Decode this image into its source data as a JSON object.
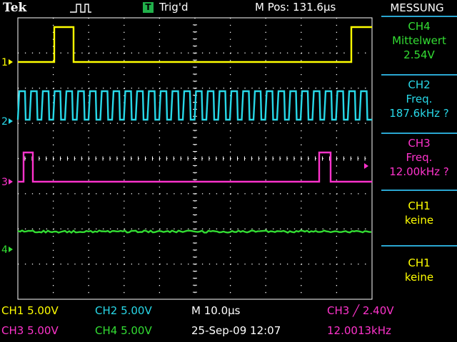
{
  "header": {
    "brand": "Tek",
    "trigger_icon": "T",
    "trigger_state": "Trig'd",
    "m_pos": "M Pos: 131.6µs"
  },
  "colors": {
    "ch1": "#ffff00",
    "ch2": "#28d8e8",
    "ch3": "#ff33cc",
    "ch4": "#33dd33",
    "grid": "#ffffff",
    "panel_border": "#2aa6d1"
  },
  "channel_markers": [
    "1",
    "2",
    "3",
    "4"
  ],
  "panel": {
    "title": "MESSUNG",
    "measurements": [
      {
        "channel": "CH4",
        "label": "Mittelwert",
        "value": "2.54V",
        "color": "#33dd33"
      },
      {
        "channel": "CH2",
        "label": "Freq.",
        "value": "187.6kHz ?",
        "color": "#28d8e8"
      },
      {
        "channel": "CH3",
        "label": "Freq.",
        "value": "12.00kHz ?",
        "color": "#ff33cc"
      },
      {
        "channel": "CH1",
        "label": "keine",
        "value": "",
        "color": "#ffff00"
      },
      {
        "channel": "CH1",
        "label": "keine",
        "value": "",
        "color": "#ffff00"
      }
    ]
  },
  "status": {
    "ch1_scale": "CH1  5.00V",
    "ch2_scale": "CH2  5.00V",
    "ch3_scale": "CH3  5.00V",
    "ch4_scale": "CH4  5.00V",
    "timebase": "M 10.0µs",
    "trigger": "CH3  ╱  2.40V",
    "datetime": "25-Sep-09 12:07",
    "trigger_freq": "12.0013kHz"
  }
}
